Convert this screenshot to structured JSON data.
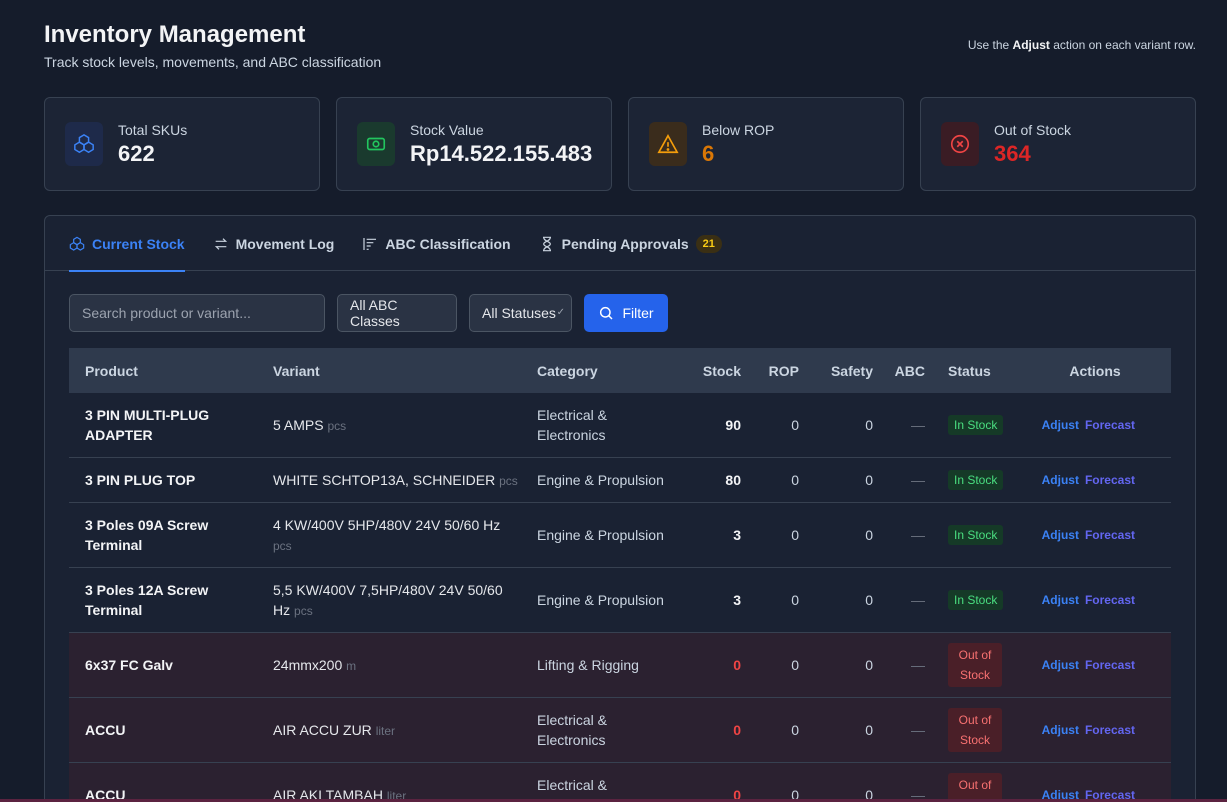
{
  "header": {
    "title": "Inventory Management",
    "subtitle": "Track stock levels, movements, and ABC classification",
    "hint_prefix": "Use the",
    "hint_bold": "Adjust",
    "hint_suffix": "action on each variant row."
  },
  "stats": [
    {
      "label": "Total SKUs",
      "value": "622",
      "icon": "cubes-icon",
      "color": "#3b82f6"
    },
    {
      "label": "Stock Value",
      "value": "Rp14.522.155.483",
      "icon": "money-icon",
      "color": "#22c55e"
    },
    {
      "label": "Below ROP",
      "value": "6",
      "icon": "warning-icon",
      "color": "#d97706"
    },
    {
      "label": "Out of Stock",
      "value": "364",
      "icon": "x-circle-icon",
      "color": "#dc2626"
    }
  ],
  "tabs": [
    {
      "label": "Current Stock",
      "icon": "cubes-icon",
      "active": true
    },
    {
      "label": "Movement Log",
      "icon": "arrows-icon"
    },
    {
      "label": "ABC Classification",
      "icon": "bars-icon"
    },
    {
      "label": "Pending Approvals",
      "icon": "hourglass-icon",
      "badge": "21"
    }
  ],
  "filters": {
    "search_placeholder": "Search product or variant...",
    "abc_selected": "All ABC Classes",
    "status_selected": "All Statuses",
    "filter_label": "Filter"
  },
  "table": {
    "columns": [
      "Product",
      "Variant",
      "Category",
      "Stock",
      "ROP",
      "Safety",
      "ABC",
      "Status",
      "Actions"
    ],
    "action_adjust": "Adjust",
    "action_forecast": "Forecast",
    "rows": [
      {
        "product": "3 PIN MULTI-PLUG ADAPTER",
        "variant": "5 AMPS",
        "unit": "pcs",
        "category": "Electrical & Electronics",
        "stock": "90",
        "rop": "0",
        "safety": "0",
        "abc": "—",
        "status": "In Stock"
      },
      {
        "product": "3 PIN PLUG TOP",
        "variant": "WHITE SCHTOP13A, SCHNEIDER",
        "unit": "pcs",
        "category": "Engine & Propulsion",
        "stock": "80",
        "rop": "0",
        "safety": "0",
        "abc": "—",
        "status": "In Stock"
      },
      {
        "product": "3 Poles 09A Screw Terminal",
        "variant": "4 KW/400V 5HP/480V 24V 50/60 Hz",
        "unit": "pcs",
        "category": "Engine & Propulsion",
        "stock": "3",
        "rop": "0",
        "safety": "0",
        "abc": "—",
        "status": "In Stock"
      },
      {
        "product": "3 Poles 12A Screw Terminal",
        "variant": "5,5 KW/400V 7,5HP/480V 24V 50/60 Hz",
        "unit": "pcs",
        "category": "Engine & Propulsion",
        "stock": "3",
        "rop": "0",
        "safety": "0",
        "abc": "—",
        "status": "In Stock"
      },
      {
        "product": "6x37 FC Galv",
        "variant": "24mmx200",
        "unit": "m",
        "category": "Lifting & Rigging",
        "stock": "0",
        "rop": "0",
        "safety": "0",
        "abc": "—",
        "status": "Out of Stock"
      },
      {
        "product": "ACCU",
        "variant": "AIR ACCU ZUR",
        "unit": "liter",
        "category": "Electrical & Electronics",
        "stock": "0",
        "rop": "0",
        "safety": "0",
        "abc": "—",
        "status": "Out of Stock"
      },
      {
        "product": "ACCU",
        "variant": "AIR AKI TAMBAH",
        "unit": "liter",
        "category": "Electrical & Electronics",
        "stock": "0",
        "rop": "0",
        "safety": "0",
        "abc": "—",
        "status": "Out of Stock"
      }
    ]
  }
}
